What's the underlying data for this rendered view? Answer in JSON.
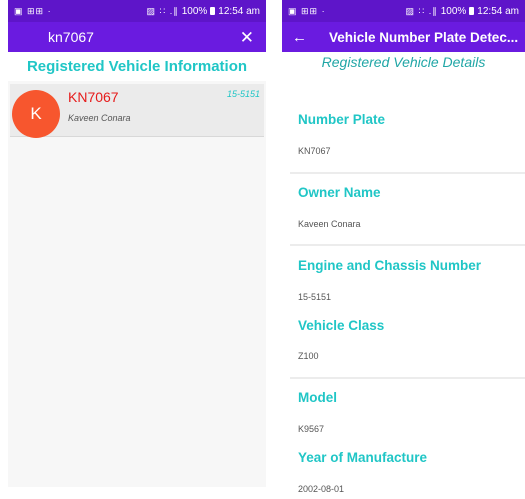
{
  "left": {
    "status": {
      "icons_left": "▣ ⊞⊞ ·",
      "icons_right": "▨ ∷ .∥",
      "battery": "100%",
      "time": "12:54 am"
    },
    "search_query": "kn7067",
    "close_icon": "✕",
    "heading": "Registered Vehicle Information",
    "results": [
      {
        "avatar_letter": "K",
        "plate": "KN7067",
        "owner": "Kaveen Conara",
        "code": "15-5151"
      }
    ]
  },
  "right": {
    "status": {
      "icons_left": "▣ ⊞⊞ ·",
      "icons_right": "▨ ∷ .∥",
      "battery": "100%",
      "time": "12:54 am"
    },
    "back_icon": "←",
    "title": "Vehicle Number Plate Detec...",
    "heading": "Registered Vehicle  Details",
    "fields": [
      {
        "label": "Number Plate",
        "value": "KN7067"
      },
      {
        "label": "Owner Name",
        "value": "Kaveen Conara"
      },
      {
        "label": "Engine and Chassis Number",
        "value": "15-5151"
      },
      {
        "label": "Vehicle Class",
        "value": "Z100"
      },
      {
        "label": "Model",
        "value": "K9567"
      },
      {
        "label": "Year of Manufacture",
        "value": "2002-08-01"
      }
    ]
  },
  "colors": {
    "appbar": "#6a1be0",
    "statusbar": "#5e15c9",
    "accent": "#20c6c6",
    "plate": "#e61b1b",
    "avatar": "#f7562e"
  }
}
